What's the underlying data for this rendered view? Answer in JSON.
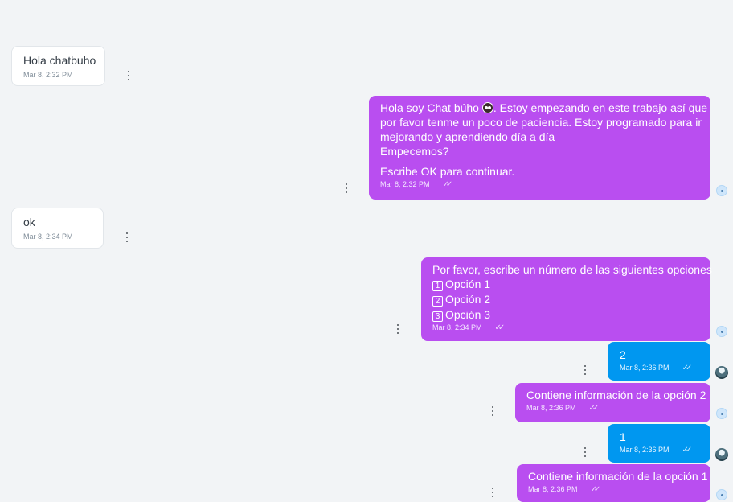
{
  "messages": {
    "m1": {
      "text": "Hola chatbuho",
      "time": "Mar 8, 2:32 PM"
    },
    "m2": {
      "line1_pre": "Hola soy Chat búho",
      "line1_post": ". Estoy empezando en este trabajo así que",
      "line2": "por favor tenme un poco de paciencia. Estoy programado para ir",
      "line3": "mejorando y aprendiendo día a día",
      "line4": "Empecemos?",
      "line5": "Escribe OK para continuar.",
      "time": "Mar 8, 2:32 PM",
      "owl_icon": "owl-emoji"
    },
    "m3": {
      "text": "ok",
      "time": "Mar 8, 2:34 PM"
    },
    "m4": {
      "line1": "Por favor, escribe un número de las siguientes opciones",
      "options": [
        {
          "key": "1",
          "label": "Opción 1"
        },
        {
          "key": "2",
          "label": "Opción 2"
        },
        {
          "key": "3",
          "label": "Opción 3"
        }
      ],
      "time": "Mar 8, 2:34 PM"
    },
    "m5": {
      "text": "2",
      "time": "Mar 8, 2:36 PM"
    },
    "m6": {
      "text": "Contiene información de la opción 2",
      "time": "Mar 8, 2:36 PM"
    },
    "m7": {
      "text": "1",
      "time": "Mar 8, 2:36 PM"
    },
    "m8": {
      "text": "Contiene información de la opción 1",
      "time": "Mar 8, 2:36 PM"
    }
  },
  "colors": {
    "bot_bubble": "#b94ef0",
    "user_bubble": "#0097f0",
    "incoming_bubble": "#ffffff",
    "background": "#f2f4f6"
  },
  "icons": {
    "more": "kebab-vertical-icon",
    "read": "double-check-icon"
  }
}
